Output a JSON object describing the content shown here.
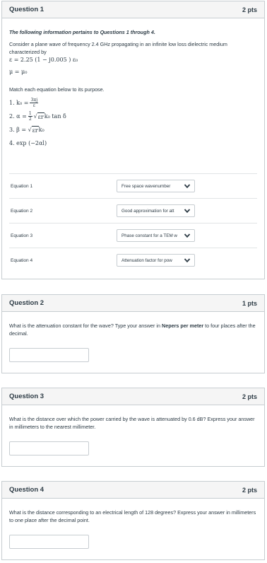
{
  "q1": {
    "title": "Question 1",
    "points": "2 pts",
    "intro": "The following information pertains to Questions 1 through 4.",
    "description": "Consider a plane wave of frequency 2.4 GHz propagating in an infinite low loss dielectric medium characterized by",
    "eps_line": "ε = 2.25 (1 − j0.005 ) ε₀",
    "mu_line": "μ = μ₀",
    "match_prompt": "Match each equation below to its purpose.",
    "equations": {
      "e1_prefix": "1.  k₀ =",
      "e1_num": "3πj",
      "e1_den": "ε",
      "e2_prefix": "2.  α =",
      "e2_num": "1",
      "e2_den": "2",
      "e2_sqrt": "εr",
      "e2_suffix": " k₀ tan δ",
      "e3_prefix": "3.  β =",
      "e3_sqrt": "εr",
      "e3_suffix": " k₀",
      "e4": "4.  exp (−2αl)"
    },
    "matches": [
      {
        "label": "Equation 1",
        "selected": "Free space wavenumber"
      },
      {
        "label": "Equation 2",
        "selected": "Good approximation for att"
      },
      {
        "label": "Equation 3",
        "selected": "Phase constant for a TEM w"
      },
      {
        "label": "Equation 4",
        "selected": "Attenuation factor for pow"
      }
    ]
  },
  "q2": {
    "title": "Question 2",
    "points": "1 pts",
    "text_before": "What is the attenuation constant for the wave? Type your answer in ",
    "text_bold": "Nepers per meter",
    "text_after": " to four places after the decimal.",
    "answer": ""
  },
  "q3": {
    "title": "Question 3",
    "points": "2 pts",
    "text": "What is the distance over which the power carried by the wave is attenuated by 0.6 dB? Express your answer in millimeters to the nearest millimeter.",
    "answer": ""
  },
  "q4": {
    "title": "Question 4",
    "points": "2 pts",
    "text": "What is the distance corresponding to an electrical length of 128 degrees? Express your answer in millimeters to one place after the decimal point.",
    "answer": ""
  }
}
